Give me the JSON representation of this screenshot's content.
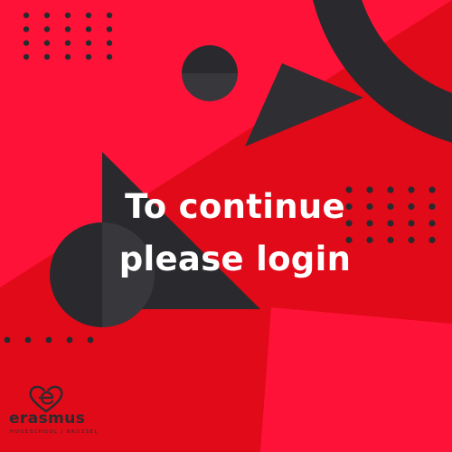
{
  "headline": {
    "line1": "To continue",
    "line2": "please login"
  },
  "logo": {
    "wordmark": "erasmus",
    "tagline": "HOGESCHOOL | BRUSSEL",
    "icon": "erasmus-e-heart-icon"
  },
  "colors": {
    "background_bright": "#ff1238",
    "background_dark": "#e10a18",
    "shape_dark": "#2a2a2e",
    "shape_dark_light": "#37373c",
    "text": "#ffffff"
  },
  "decorations": {
    "dot_grid_top_left": "dot-grid-icon",
    "dot_grid_right": "dot-grid-icon",
    "dot_row_left": "dot-row-icon",
    "circle_small": "half-circle-icon",
    "circle_large": "half-circle-icon",
    "triangle_top": "triangle-icon",
    "triangle_center": "triangle-icon",
    "arc_top_right": "arc-icon"
  }
}
